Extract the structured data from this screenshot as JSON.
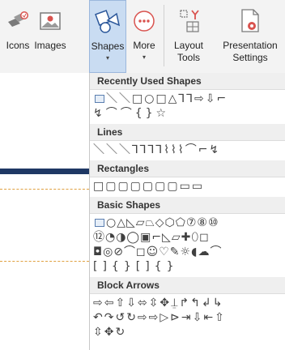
{
  "ribbon": {
    "icons_label": "Icons",
    "images_label": "Images",
    "shapes_label": "Shapes",
    "more_label": "More",
    "layout_tools_line1": "Layout",
    "layout_tools_line2": "Tools",
    "presentation_settings_line1": "Presentation",
    "presentation_settings_line2": "Settings",
    "dropdown_glyph": "▾"
  },
  "gallery": {
    "recently_used": {
      "title": "Recently Used Shapes",
      "rows": [
        "＼＼□○□△⅂⅂⇨⇩⌐",
        "↯⌒⌒{}☆"
      ]
    },
    "lines": {
      "title": "Lines",
      "rows": [
        "＼＼＼⅂⅂⅂⅂⌇⌇⌇⌒⌐↯"
      ]
    },
    "rectangles": {
      "title": "Rectangles",
      "rows": [
        "□▢▢▢▢▢▢▭▭"
      ]
    },
    "basic_shapes": {
      "title": "Basic Shapes",
      "rows": [
        "○△◺▱⏢◇⬡⬠⑦⑧⑩",
        "⑫◔◑◯▣⌐◺▱✚⬯◻",
        "◘◎⊘⌒◻☺♡✎☼◖☁⌒",
        "[]{}[]{}"
      ]
    },
    "block_arrows": {
      "title": "Block Arrows",
      "rows": [
        "⇨⇦⇧⇩⬄⇳✥⍊↱↰↲↳",
        "↶↷↺↻⇨⇨▷⊳⇥⇩⇤⇧",
        "⇳✥↻"
      ]
    }
  }
}
